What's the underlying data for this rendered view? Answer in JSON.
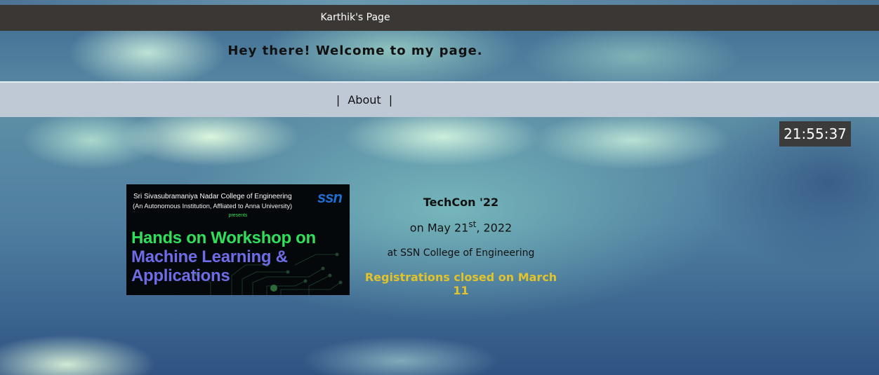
{
  "page": {
    "title": "Karthik's Page",
    "welcome": "Hey there! Welcome to my page."
  },
  "nav": {
    "separator_left": "|",
    "about_label": "About",
    "separator_right": "|"
  },
  "clock": {
    "time": "21:55:37"
  },
  "poster": {
    "college": "Sri Sivasubramaniya Nadar College of Engineering",
    "affiliation": "(An Autonomous Institution, Affliated to Anna University)",
    "presents": "presents",
    "logo": "ssn",
    "heading_line1": "Hands on Workshop on",
    "heading_line2": "Machine Learning &",
    "heading_line3": "Applications"
  },
  "event": {
    "title": "TechCon '22",
    "date_prefix": "on May 21",
    "date_suffix": "st",
    "date_year": ", 2022",
    "venue": "at SSN College of Engineering",
    "status": "Registrations closed on March 11"
  },
  "colors": {
    "titlebar_bg": "#3b3734",
    "navbar_bg": "#bfc9d6",
    "clock_bg": "#3b3b3b",
    "status_text": "#e3c32a",
    "poster_green": "#2fe05c",
    "poster_purple": "#6e6ce6",
    "poster_logo": "#1d6fd6"
  }
}
